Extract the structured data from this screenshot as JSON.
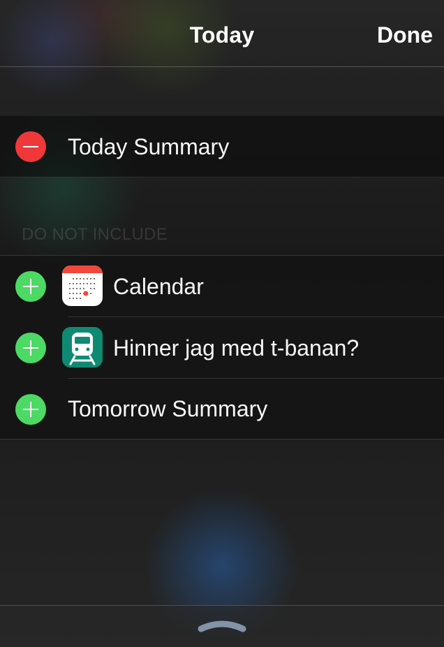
{
  "header": {
    "title": "Today",
    "done_label": "Done"
  },
  "included": {
    "items": [
      {
        "label": "Today Summary",
        "control": "remove",
        "icon": "minus-icon"
      }
    ]
  },
  "excluded": {
    "header": "DO NOT INCLUDE",
    "items": [
      {
        "label": "Calendar",
        "control": "add",
        "icon": "calendar-app-icon"
      },
      {
        "label": "Hinner jag med t-banan?",
        "control": "add",
        "icon": "train-app-icon"
      },
      {
        "label": "Tomorrow Summary",
        "control": "add",
        "icon": "plus-icon"
      }
    ]
  },
  "colors": {
    "remove": "#f0383a",
    "add": "#4cd964",
    "calendar_red": "#f2473a",
    "train_green": "#0f8a72"
  },
  "footer": {
    "grabber_icon": "chevron-up-icon"
  }
}
